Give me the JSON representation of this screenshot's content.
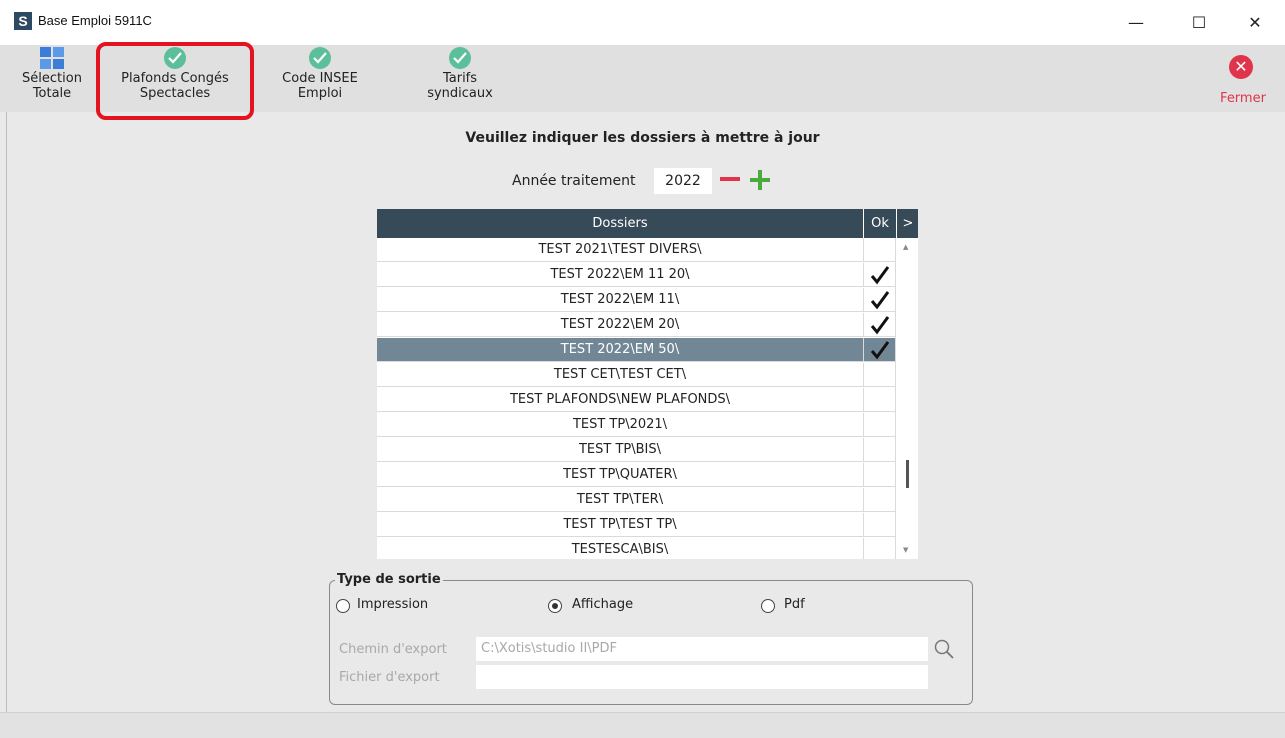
{
  "window": {
    "title": "Base Emploi 5911C",
    "logo_letter": "S",
    "minimize": "—",
    "maximize": "☐",
    "close": "✕"
  },
  "toolbar": {
    "selection_totale": [
      "Sélection",
      "Totale"
    ],
    "plafonds": [
      "Plafonds Congés",
      "Spectacles"
    ],
    "code_insee": [
      "Code INSEE",
      "Emploi"
    ],
    "tarifs": [
      "Tarifs",
      "syndicaux"
    ],
    "fermer": "Fermer",
    "accent_check": "#5bbf9c",
    "accent_close": "#e0344c",
    "highlight_color": "#e3131f"
  },
  "main": {
    "heading": "Veuillez indiquer les dossiers à mettre à jour",
    "year_label": "Année traitement",
    "year_value": "2022"
  },
  "table": {
    "col_dossiers": "Dossiers",
    "col_ok": "Ok",
    "col_arrow": ">",
    "rows": [
      {
        "name": "TEST 2021\\TEST DIVERS\\",
        "ok": false,
        "selected": false
      },
      {
        "name": "TEST 2022\\EM 11 20\\",
        "ok": true,
        "selected": false
      },
      {
        "name": "TEST 2022\\EM 11\\",
        "ok": true,
        "selected": false
      },
      {
        "name": "TEST 2022\\EM 20\\",
        "ok": true,
        "selected": false
      },
      {
        "name": "TEST 2022\\EM 50\\",
        "ok": true,
        "selected": true
      },
      {
        "name": "TEST CET\\TEST CET\\",
        "ok": false,
        "selected": false
      },
      {
        "name": "TEST PLAFONDS\\NEW PLAFONDS\\",
        "ok": false,
        "selected": false
      },
      {
        "name": "TEST TP\\2021\\",
        "ok": false,
        "selected": false
      },
      {
        "name": "TEST TP\\BIS\\",
        "ok": false,
        "selected": false
      },
      {
        "name": "TEST TP\\QUATER\\",
        "ok": false,
        "selected": false
      },
      {
        "name": "TEST TP\\TER\\",
        "ok": false,
        "selected": false
      },
      {
        "name": "TEST TP\\TEST TP\\",
        "ok": false,
        "selected": false
      },
      {
        "name": "TESTESCA\\BIS\\",
        "ok": false,
        "selected": false
      }
    ]
  },
  "output": {
    "title": "Type de sortie",
    "options": [
      "Impression",
      "Affichage",
      "Pdf"
    ],
    "selected": "Affichage",
    "export_path_label": "Chemin d'export",
    "export_path_value": "C:\\Xotis\\studio II\\PDF",
    "export_file_label": "Fichier d'export",
    "export_file_value": ""
  }
}
